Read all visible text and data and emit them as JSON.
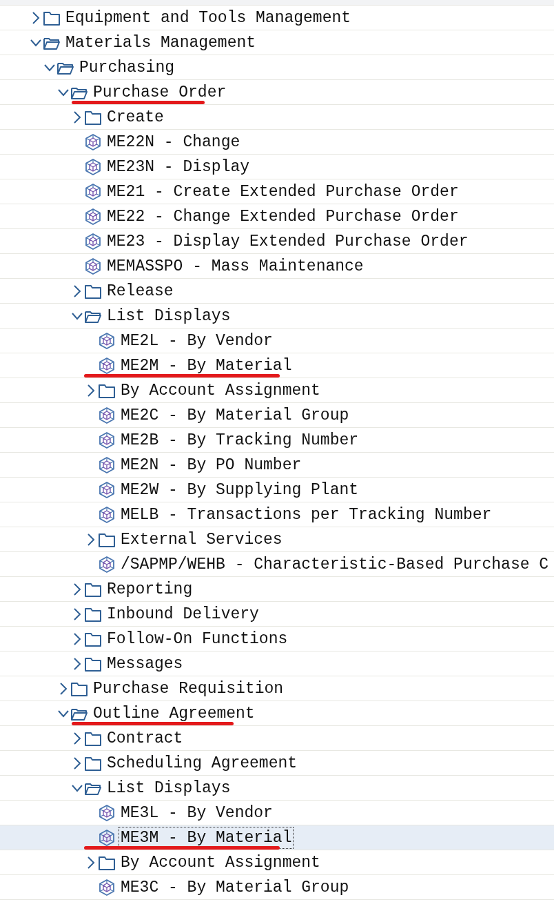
{
  "tree": [
    {
      "kind": "folder",
      "label": "Equipment and Tools Management",
      "expanded": false,
      "selected": false,
      "underlined": false
    },
    {
      "kind": "folder",
      "label": "Materials Management",
      "expanded": true,
      "selected": false,
      "underlined": false,
      "children": [
        {
          "kind": "folder",
          "label": "Purchasing",
          "expanded": true,
          "selected": false,
          "underlined": false,
          "children": [
            {
              "kind": "folder",
              "label": "Purchase Order",
              "expanded": true,
              "selected": false,
              "underlined": true,
              "children": [
                {
                  "kind": "folder",
                  "label": "Create",
                  "expanded": false,
                  "selected": false,
                  "underlined": false
                },
                {
                  "kind": "transaction",
                  "label": "ME22N - Change",
                  "selected": false,
                  "underlined": false
                },
                {
                  "kind": "transaction",
                  "label": "ME23N - Display",
                  "selected": false,
                  "underlined": false
                },
                {
                  "kind": "transaction",
                  "label": "ME21 - Create Extended Purchase Order",
                  "selected": false,
                  "underlined": false
                },
                {
                  "kind": "transaction",
                  "label": "ME22 - Change Extended Purchase Order",
                  "selected": false,
                  "underlined": false
                },
                {
                  "kind": "transaction",
                  "label": "ME23 - Display Extended Purchase Order",
                  "selected": false,
                  "underlined": false
                },
                {
                  "kind": "transaction",
                  "label": "MEMASSPO - Mass Maintenance",
                  "selected": false,
                  "underlined": false
                },
                {
                  "kind": "folder",
                  "label": "Release",
                  "expanded": false,
                  "selected": false,
                  "underlined": false
                },
                {
                  "kind": "folder",
                  "label": "List Displays",
                  "expanded": true,
                  "selected": false,
                  "underlined": false,
                  "children": [
                    {
                      "kind": "transaction",
                      "label": "ME2L - By Vendor",
                      "selected": false,
                      "underlined": false
                    },
                    {
                      "kind": "transaction",
                      "label": "ME2M - By Material",
                      "selected": false,
                      "underlined": true
                    },
                    {
                      "kind": "folder",
                      "label": "By Account Assignment",
                      "expanded": false,
                      "selected": false,
                      "underlined": false
                    },
                    {
                      "kind": "transaction",
                      "label": "ME2C - By Material Group",
                      "selected": false,
                      "underlined": false
                    },
                    {
                      "kind": "transaction",
                      "label": "ME2B - By Tracking Number",
                      "selected": false,
                      "underlined": false
                    },
                    {
                      "kind": "transaction",
                      "label": "ME2N - By PO Number",
                      "selected": false,
                      "underlined": false
                    },
                    {
                      "kind": "transaction",
                      "label": "ME2W - By Supplying Plant",
                      "selected": false,
                      "underlined": false
                    },
                    {
                      "kind": "transaction",
                      "label": "MELB - Transactions per Tracking Number",
                      "selected": false,
                      "underlined": false
                    },
                    {
                      "kind": "folder",
                      "label": "External Services",
                      "expanded": false,
                      "selected": false,
                      "underlined": false
                    },
                    {
                      "kind": "transaction",
                      "label": "/SAPMP/WEHB - Characteristic-Based Purchase C",
                      "selected": false,
                      "underlined": false
                    }
                  ]
                },
                {
                  "kind": "folder",
                  "label": "Reporting",
                  "expanded": false,
                  "selected": false,
                  "underlined": false
                },
                {
                  "kind": "folder",
                  "label": "Inbound Delivery",
                  "expanded": false,
                  "selected": false,
                  "underlined": false
                },
                {
                  "kind": "folder",
                  "label": "Follow-On Functions",
                  "expanded": false,
                  "selected": false,
                  "underlined": false
                },
                {
                  "kind": "folder",
                  "label": "Messages",
                  "expanded": false,
                  "selected": false,
                  "underlined": false
                }
              ]
            },
            {
              "kind": "folder",
              "label": "Purchase Requisition",
              "expanded": false,
              "selected": false,
              "underlined": false
            },
            {
              "kind": "folder",
              "label": "Outline Agreement",
              "expanded": true,
              "selected": false,
              "underlined": true,
              "children": [
                {
                  "kind": "folder",
                  "label": "Contract",
                  "expanded": false,
                  "selected": false,
                  "underlined": false
                },
                {
                  "kind": "folder",
                  "label": "Scheduling Agreement",
                  "expanded": false,
                  "selected": false,
                  "underlined": false
                },
                {
                  "kind": "folder",
                  "label": "List Displays",
                  "expanded": true,
                  "selected": false,
                  "underlined": false,
                  "children": [
                    {
                      "kind": "transaction",
                      "label": "ME3L - By Vendor",
                      "selected": false,
                      "underlined": false
                    },
                    {
                      "kind": "transaction",
                      "label": "ME3M - By Material",
                      "selected": true,
                      "underlined": true
                    },
                    {
                      "kind": "folder",
                      "label": "By Account Assignment",
                      "expanded": false,
                      "selected": false,
                      "underlined": false
                    },
                    {
                      "kind": "transaction",
                      "label": "ME3C - By Material Group",
                      "selected": false,
                      "underlined": false
                    }
                  ]
                }
              ]
            }
          ]
        }
      ]
    }
  ]
}
